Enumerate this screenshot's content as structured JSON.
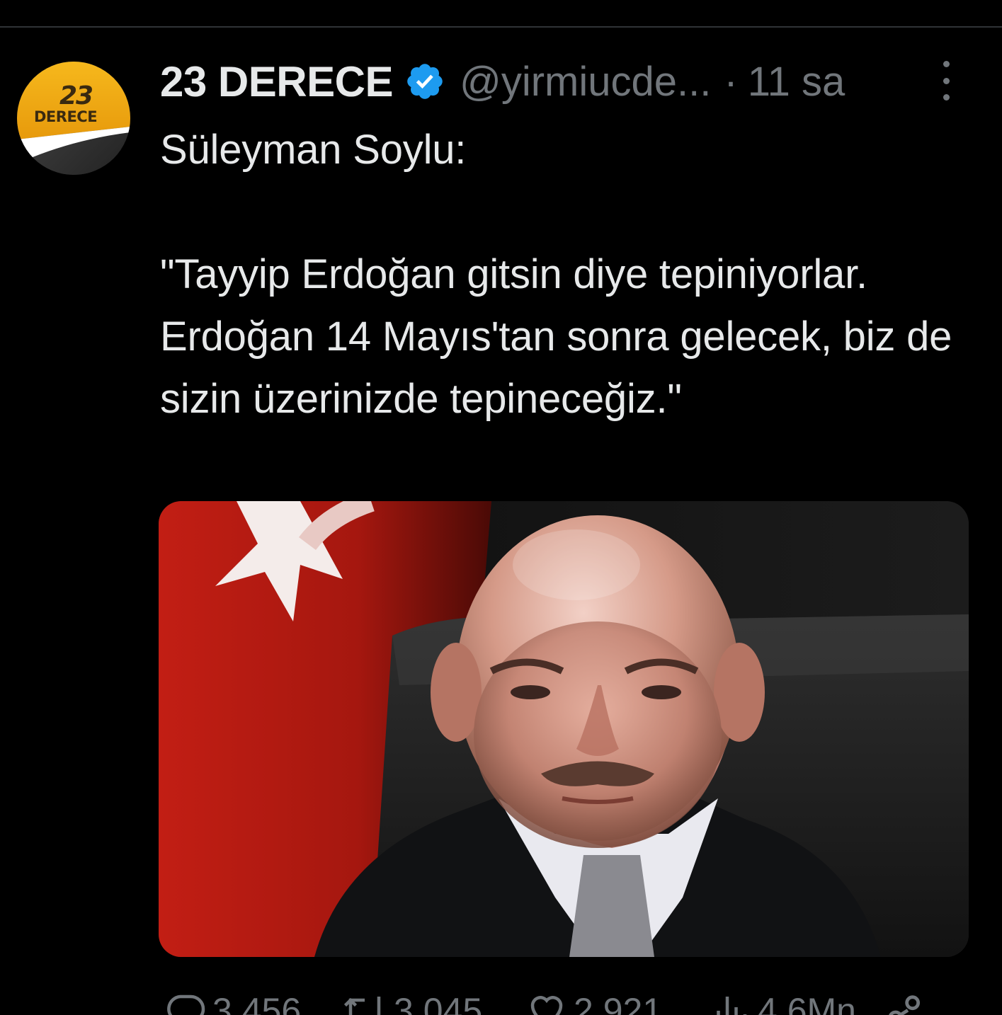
{
  "tweet": {
    "display_name": "23 DERECE",
    "handle": "@yirmiucde...",
    "separator": "·",
    "time": "11 sa",
    "avatar": {
      "icon": "23-derece-logo-icon",
      "logo_top": "23",
      "logo_bottom": "DERECE"
    },
    "text": "Süleyman Soylu:\n\n\"Tayyip Erdoğan gitsin diye tepiniyorlar. Erdoğan 14 Mayıs'tan sonra gelecek, biz de sizin üzerinizde tepineceğiz.\"",
    "media": {
      "icon": "photo-man-in-suit-with-turkish-flag"
    }
  },
  "actions": {
    "reply_count": "3.456",
    "retweet_count": "3.045",
    "like_count": "2.921",
    "views_count": "4,6Mn"
  },
  "colors": {
    "background": "#000000",
    "text_primary": "#e7e9ea",
    "text_secondary": "#71767b",
    "verified_blue": "#1d9bf0",
    "divider": "#2f3336"
  }
}
